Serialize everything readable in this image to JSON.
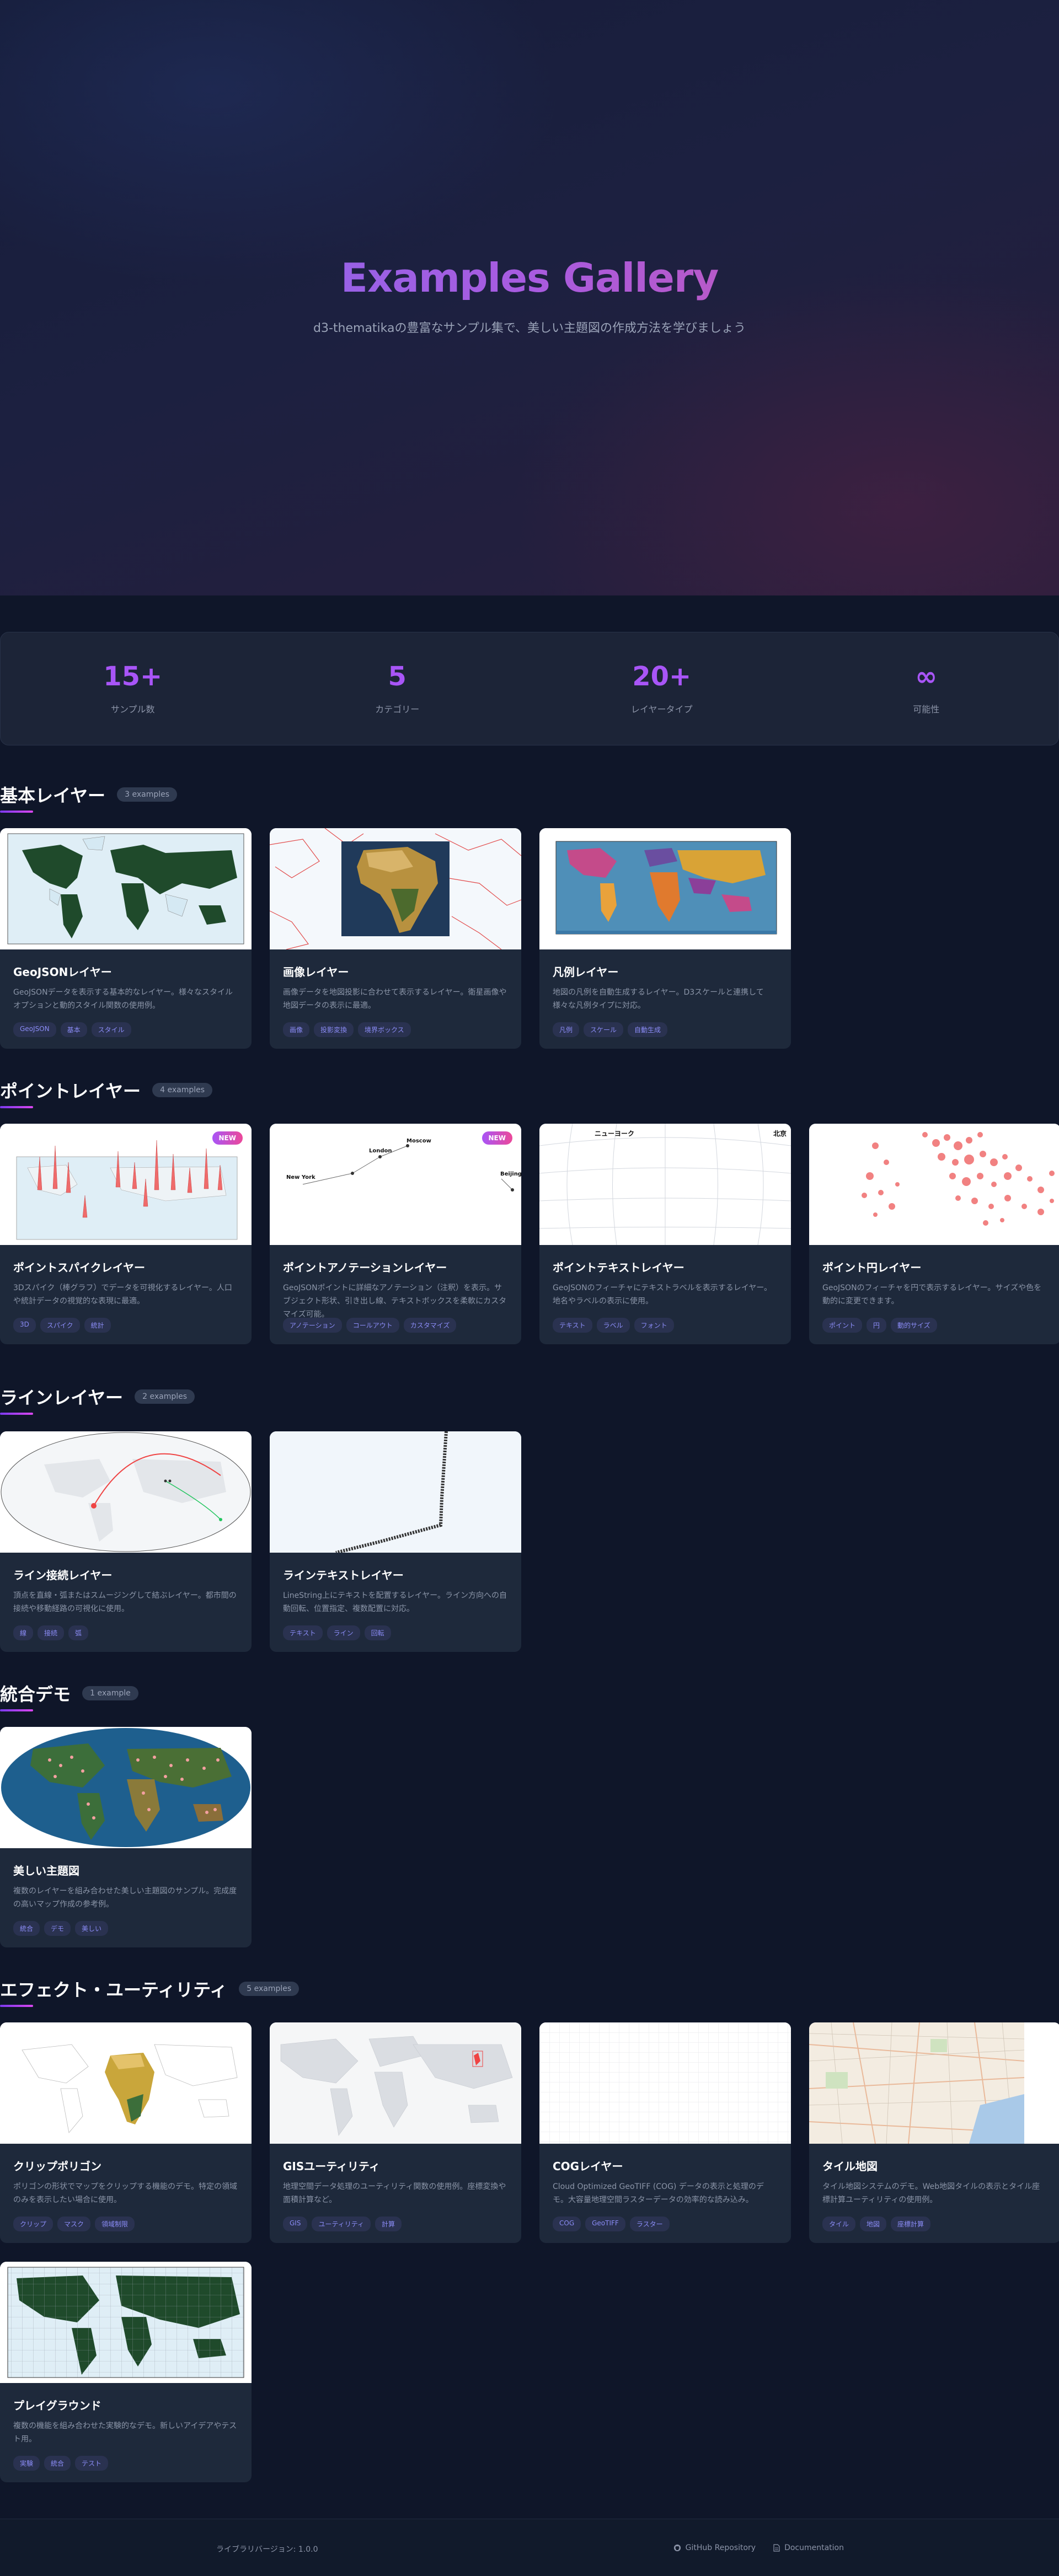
{
  "hero": {
    "title": "Examples Gallery",
    "subtitle": "d3-thematikaの豊富なサンプル集で、美しい主題図の作成方法を学びましょう"
  },
  "stats": [
    {
      "value": "15+",
      "label": "サンプル数"
    },
    {
      "value": "5",
      "label": "カテゴリー"
    },
    {
      "value": "20+",
      "label": "レイヤータイプ"
    },
    {
      "value": "∞",
      "label": "可能性"
    }
  ],
  "sections": [
    {
      "title": "基本レイヤー",
      "count": "3 examples",
      "cards": [
        {
          "title": "GeoJSONレイヤー",
          "desc": "GeoJSONデータを表示する基本的なレイヤー。様々なスタイルオプションと動的スタイル関数の使用例。",
          "tags": [
            "GeoJSON",
            "基本",
            "スタイル"
          ],
          "new": ""
        },
        {
          "title": "画像レイヤー",
          "desc": "画像データを地図投影に合わせて表示するレイヤー。衛星画像や地図データの表示に最適。",
          "tags": [
            "画像",
            "投影変換",
            "境界ボックス"
          ],
          "new": ""
        },
        {
          "title": "凡例レイヤー",
          "desc": "地図の凡例を自動生成するレイヤー。D3スケールと連携して様々な凡例タイプに対応。",
          "tags": [
            "凡例",
            "スケール",
            "自動生成"
          ],
          "new": ""
        }
      ]
    },
    {
      "title": "ポイントレイヤー",
      "count": "4 examples",
      "cards": [
        {
          "title": "ポイントスパイクレイヤー",
          "desc": "3Dスパイク（棒グラフ）でデータを可視化するレイヤー。人口や統計データの視覚的な表現に最適。",
          "tags": [
            "3D",
            "スパイク",
            "統計"
          ],
          "new": "NEW"
        },
        {
          "title": "ポイントアノテーションレイヤー",
          "desc": "GeoJSONポイントに詳細なアノテーション（注釈）を表示。サブジェクト形状、引き出し線、テキストボックスを柔軟にカスタマイズ可能。",
          "tags": [
            "アノテーション",
            "コールアウト",
            "カスタマイズ"
          ],
          "new": "NEW"
        },
        {
          "title": "ポイントテキストレイヤー",
          "desc": "GeoJSONのフィーチャにテキストラベルを表示するレイヤー。地名やラベルの表示に使用。",
          "tags": [
            "テキスト",
            "ラベル",
            "フォント"
          ],
          "new": ""
        },
        {
          "title": "ポイント円レイヤー",
          "desc": "GeoJSONのフィーチャを円で表示するレイヤー。サイズや色を動的に変更できます。",
          "tags": [
            "ポイント",
            "円",
            "動的サイズ"
          ],
          "new": ""
        }
      ]
    },
    {
      "title": "ラインレイヤー",
      "count": "2 examples",
      "cards": [
        {
          "title": "ライン接続レイヤー",
          "desc": "頂点を直線・弧またはスムージングして結ぶレイヤー。都市間の接続や移動経路の可視化に使用。",
          "tags": [
            "線",
            "接続",
            "弧"
          ],
          "new": ""
        },
        {
          "title": "ラインテキストレイヤー",
          "desc": "LineString上にテキストを配置するレイヤー。ライン方向への自動回転、位置指定、複数配置に対応。",
          "tags": [
            "テキスト",
            "ライン",
            "回転"
          ],
          "new": ""
        }
      ]
    },
    {
      "title": "統合デモ",
      "count": "1 example",
      "cards": [
        {
          "title": "美しい主題図",
          "desc": "複数のレイヤーを組み合わせた美しい主題図のサンプル。完成度の高いマップ作成の参考例。",
          "tags": [
            "統合",
            "デモ",
            "美しい"
          ],
          "new": ""
        }
      ]
    },
    {
      "title": "エフェクト・ユーティリティ",
      "count": "5 examples",
      "cards": [
        {
          "title": "クリップポリゴン",
          "desc": "ポリゴンの形状でマップをクリップする機能のデモ。特定の領域のみを表示したい場合に使用。",
          "tags": [
            "クリップ",
            "マスク",
            "領域制限"
          ],
          "new": ""
        },
        {
          "title": "GISユーティリティ",
          "desc": "地理空間データ処理のユーティリティ関数の使用例。座標変換や面積計算など。",
          "tags": [
            "GIS",
            "ユーティリティ",
            "計算"
          ],
          "new": ""
        },
        {
          "title": "COGレイヤー",
          "desc": "Cloud Optimized GeoTIFF (COG) データの表示と処理のデモ。大容量地理空間ラスターデータの効率的な読み込み。",
          "tags": [
            "COG",
            "GeoTIFF",
            "ラスター"
          ],
          "new": ""
        },
        {
          "title": "タイル地図",
          "desc": "タイル地図システムのデモ。Web地図タイルの表示とタイル座標計算ユーティリティの使用例。",
          "tags": [
            "タイル",
            "地図",
            "座標計算"
          ],
          "new": ""
        },
        {
          "title": "プレイグラウンド",
          "desc": "複数の機能を組み合わせた実験的なデモ。新しいアイデアやテスト用。",
          "tags": [
            "実験",
            "統合",
            "テスト"
          ],
          "new": ""
        }
      ]
    }
  ],
  "annotation_labels": [
    "New York",
    "London",
    "Moscow",
    "Beijing"
  ],
  "text_labels": [
    "ニューヨーク",
    "北京"
  ],
  "footer": {
    "version": "ライブラリバージョン: 1.0.0",
    "repo": "GitHub Repository",
    "docs": "Documentation"
  },
  "colors": {
    "accent": "#a855f7",
    "card": "#1e293b",
    "background": "#0f1629"
  }
}
